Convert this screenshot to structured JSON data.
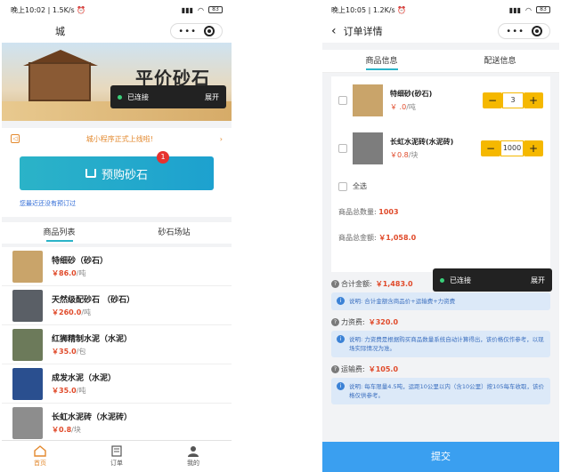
{
  "left": {
    "status": {
      "time": "晚上10:02",
      "speed": "1.5K/s",
      "battery": "83"
    },
    "nav": {
      "title": "城"
    },
    "banner": {
      "title": "平价砂石"
    },
    "toast": {
      "status": "已连接",
      "action": "展开"
    },
    "notice": {
      "text": "城小程序正式上线啦!"
    },
    "presale": {
      "label": "预购砂石",
      "badge": "1",
      "hint": "您最近还没有预订过"
    },
    "tabs": [
      "商品列表",
      "砂石场站"
    ],
    "products": [
      {
        "name": "特细砂（砂石）",
        "price": "￥86.0",
        "unit": "/吨",
        "color": "#c9a46a"
      },
      {
        "name": "天然级配砂石 （砂石）",
        "price": "￥260.0",
        "unit": "/吨",
        "color": "#5a5f66"
      },
      {
        "name": "红狮精制水泥（水泥）",
        "price": "￥35.0",
        "unit": "/包",
        "color": "#6c7a5a"
      },
      {
        "name": "成发水泥（水泥）",
        "price": "￥35.0",
        "unit": "/吨",
        "color": "#2a4f8f"
      },
      {
        "name": "长虹水泥砖（水泥砖）",
        "price": "￥0.8",
        "unit": "/块",
        "color": "#8d8d8d"
      }
    ],
    "tabbar": [
      "首页",
      "订单",
      "我的"
    ]
  },
  "right": {
    "status": {
      "time": "晚上10:05",
      "speed": "1.2K/s",
      "battery": "83"
    },
    "nav": {
      "title": "订单详情"
    },
    "tabs": [
      "商品信息",
      "配送信息"
    ],
    "items": [
      {
        "name": "特细砂(砂石)",
        "price": "￥ .0",
        "unit": "/吨",
        "qty": "3",
        "color": "#c9a46a"
      },
      {
        "name": "长虹水泥砖(水泥砖)",
        "price": "￥0.8",
        "unit": "/块",
        "qty": "1000",
        "color": "#7d7d7d"
      }
    ],
    "select_all": "全选",
    "total_qty_label": "商品总数量:",
    "total_qty": "1003",
    "total_amount_label": "商品总金额:",
    "total_amount": "￥1,058.0",
    "toast": {
      "status": "已连接",
      "action": "展开"
    },
    "fees": [
      {
        "label": "合计金额:",
        "value": "￥1,483.0",
        "note": "说明: 合计金额含商品价+运输费+力资费"
      },
      {
        "label": "力资费:",
        "value": "￥320.0",
        "note": "说明: 力资费是根据购买商品数量系统自动计算得出，该价格仅作参考，以现场实际情况为准。"
      },
      {
        "label": "运输费:",
        "value": "￥105.0",
        "note": "说明: 每车限量4.5吨，运距10公里以内（含10公里）按105每车收取，该价格仅供参考。"
      }
    ],
    "submit": "提交"
  },
  "colors": {
    "accent": "#2bb3c8",
    "price": "#e04a2a",
    "stepper": "#f5b800",
    "submit": "#3a9ff0"
  }
}
